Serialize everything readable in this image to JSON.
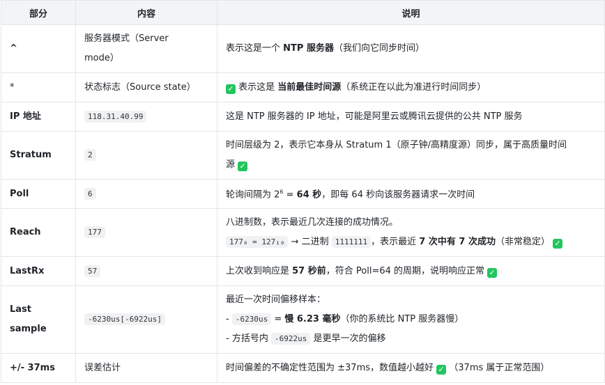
{
  "headers": [
    "部分",
    "内容",
    "说明"
  ],
  "rows": {
    "r1": {
      "part": "^",
      "content_a": "服务器模式（Server",
      "content_b": "mode）",
      "desc_pre": "表示这是一个 ",
      "desc_bold": "NTP 服务器",
      "desc_post": "（我们向它同步时间）"
    },
    "r2": {
      "part": "*",
      "content": "状态标志（Source state）",
      "desc_pre": " 表示这是 ",
      "desc_bold": "当前最佳时间源",
      "desc_post": "（系统正在以此为准进行时间同步）"
    },
    "r3": {
      "part": "IP 地址",
      "code": "118.31.40.99",
      "desc": "这是 NTP 服务器的 IP 地址，可能是阿里云或腾讯云提供的公共 NTP 服务"
    },
    "r4": {
      "part": "Stratum",
      "code": "2",
      "desc_a": "时间层级为 2，表示它本身从 Stratum 1（原子钟/高精度源）同步，属于高质量时间",
      "desc_b": "源 "
    },
    "r5": {
      "part": "Poll",
      "code": "6",
      "desc_pre": "轮询间隔为 2",
      "desc_sup": "6",
      "desc_mid": " = ",
      "desc_bold": "64 秒",
      "desc_post": "，即每 64 秒向该服务器请求一次时间"
    },
    "r6": {
      "part": "Reach",
      "code": "177",
      "desc_a": "八进制数，表示最近几次连接的成功情况。",
      "code_b": "177₈ = 127₁₀",
      "arrow": " → 二进制 ",
      "code_c": "1111111",
      "mid": "，表示最近 ",
      "bold": "7 次中有 7 次成功",
      "post": "（非常稳定）"
    },
    "r7": {
      "part": "LastRx",
      "code": "57",
      "desc_pre": "上次收到响应是 ",
      "desc_bold": "57 秒前",
      "desc_post": "，符合 Poll=64 的周期，说明响应正常 "
    },
    "r8": {
      "part_a": "Last",
      "part_b": "sample",
      "code": "-6230us[-6922us]",
      "line1": "最近一次时间偏移样本：",
      "l2_pre": "- ",
      "l2_code": "-6230us",
      "l2_eq": " = ",
      "l2_bold": "慢 6.23 毫秒",
      "l2_post": "（你的系统比 NTP 服务器慢）",
      "l3_pre": "- 方括号内 ",
      "l3_code": "-6922us",
      "l3_post": " 是更早一次的偏移"
    },
    "r9": {
      "part": "+/- 37ms",
      "content": "误差估计",
      "desc_pre": "时间偏差的不确定性范围为 ±37ms，数值越小越好 ",
      "desc_post": " （37ms 属于正常范围）"
    }
  },
  "icons": {
    "check": "checkmark-icon",
    "check_color": "#22c55e"
  }
}
